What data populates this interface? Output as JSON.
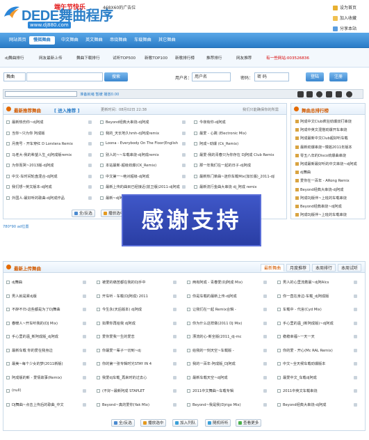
{
  "header": {
    "logo_text": "DEDE舞曲程序",
    "badge": "端午节快乐",
    "url": "www.dj880.com",
    "ad": "468X60的广告位",
    "links": [
      "设为首页",
      "加入收藏",
      "分享本站"
    ]
  },
  "nav": {
    "items": [
      "网站首页",
      "慢摇舞曲",
      "中文舞曲",
      "英文舞曲",
      "串烧舞曲",
      "车载舞曲",
      "其它舞曲"
    ]
  },
  "subnav": {
    "items": [
      "dj舞曲排行",
      "网友最新上传",
      "舞曲下载排行",
      "试听TOP500",
      "新歌TOP100",
      "新歌排行榜",
      "推荐排行",
      "网友推荐",
      "有一些网站:003526836"
    ]
  },
  "search": {
    "type_value": "舞曲",
    "button": "搜索",
    "username_label": "用户名：",
    "username_value": "用户名",
    "password_label": "密码：",
    "password_value": "密 码",
    "login_button": "登陆",
    "register_button": "注册"
  },
  "player": {
    "status": "准备就绪 暂缓 播放0.00"
  },
  "featured": {
    "title": "最新推荐舞曲",
    "subtitle": "[ 进入推荐 ]",
    "meta": "更新时间：08月02日 22:38",
    "more": "我们只能确保你的所需",
    "col1": [
      "最新热伤你~dj阿成",
      "当你~只为你 阿成版",
      "月亮号 - 开车穿红 D Lorstera Remix",
      "马老大-我的希望人生_dj阿成版remix",
      "为你而哭~2013版-dj阿成",
      "中文-车时间轮盘混合-dj阿成",
      "我们想~英文版本-dj阿成",
      "外国人-最好听的歌曲-dj阿成作品"
    ],
    "col2": [
      "Beyond经典大串烧-dj阿成",
      "我的_天长地久hmh-dj阿成remix",
      "Loona - Everybody On The Floor(English",
      "别人的~~车载串烧-dj阿成remix",
      "本站最新-超级劲爆(CK_Remix)",
      "中文第一~绝对超级-dj阿成",
      "最新上传的曲目已经接近(前卫版)2011-dj阿成",
      "最新~dj阿成"
    ],
    "col3": [
      "今夜有你-dj阿成",
      "最爱 - 心跳 (Electronic Mix)",
      "阿成~劲爆 (Ck_Remix)",
      "最爱-我的青春只为你存在 DJ阿成 Club Remix",
      "那一年我们在一起的日子-dj阿成",
      "最新热门单曲~迷你车载Mix(加长版)_2011-dj阿成",
      "最新流行金曲大串烧 dj_阿成 remix",
      ""
    ]
  },
  "ranking": {
    "title": "舞曲总排行榜",
    "items": [
      "阿成中文Club疯狂劲爆双打串烧",
      "阿成中英文混搭劲爆开车串烧",
      "阿成最新中文Club超好听车载",
      "最新劲爆串烧~慢摇2011年版本",
      "零五八年的Disco劲爆曲串烧",
      "阿成最新最好听的中文串烧~dj阿成",
      "dj舞曲",
      "爱你在一百年 - ARong Remix",
      "Beyond经典大串烧-dj阿成",
      "阿成DJ版伴~上班的车载串烧",
      "Beyond经典串烧~dj阿成",
      "阿成DJ版伴~上班的车载串烧"
    ]
  },
  "size_note": "780*90 ad位置",
  "feature_buttons": [
    "全/反选",
    "播放选中"
  ],
  "overlay": {
    "text": "感谢支持"
  },
  "latest": {
    "title": "最新上传舞曲",
    "tabs": [
      "最新舞曲",
      "月度推荐",
      "本周排行",
      "本周试听"
    ],
    "col1": [
      "dj舞曲",
      "男人就是累dj版",
      "不醉不归-这些都是为了Dj舞曲",
      "春暖人~开车听我的(DJ Mix)",
      "手心里的温_新阿成版_dj阿成",
      "最新车载 你的爱在我身边",
      "最美~每个少女的梦(2011新版)",
      "阿成版的新 - 爱情故事(Remix)",
      "(null)",
      "DJ舞曲~点击上传后的歌曲_中文"
    ],
    "col2": [
      "被爱的痛苦都在我的DJ手中",
      "开车听 - 车载(DJ阿成) 2011",
      "今生永(天后版本) dj阿成",
      "如果你再给我 dj阿成",
      "爱你爱我一生的爱恋",
      "你最爱一辈子一切到~dj",
      "你的第一张专辑时光STAY IN 4",
      "我爱dj车载_再来时的过去心",
      "(不好~最新阿成 STAPLET",
      "Beyond~真的爱你(Yak Mix)"
    ],
    "col3": [
      "两有阿成 - 青春爱(DJ阿成 Mix)",
      "你是车载的最新上传-dj阿成",
      "让我们在一起 Remix合辑 -",
      "你为什么这样做(2011 DJ Mix)",
      "漂流的心-新全版(2011_dj-mc",
      "给我的一刻天空~车载版 -",
      "我的一百年-阿成版_DJ阿成",
      "最新车载天空~dj阿成",
      "2011中文舞曲~车载专辑",
      "Beyond~我是我(Djrigo Mix)"
    ],
    "col4": [
      "男人的心里流着最~dj阿Alcs",
      "你一直在身边-车载_dj阿成版",
      "车载中 - 代言(Cyd Mix)",
      "手心里的温_(新阿成版)~dj阿成",
      "稳稳幸福~一天一天",
      "你的爱 - 开心(Mc RAL Remix)",
      "中文~全天候车载劲爆版本",
      "最爱中文_车载dj阿成",
      "2011中英文车载串烧",
      "Beyond经典大串烧-dj阿成"
    ]
  },
  "bottom_buttons": [
    "全/反选",
    "播放选中",
    "加入列队",
    "随机听听",
    "查看更多"
  ],
  "colors": {
    "nav_blue": "#2a7cc7",
    "title_orange": "#d25a00",
    "overlay_blue": "#3248b8",
    "red_text": "#d80000"
  }
}
